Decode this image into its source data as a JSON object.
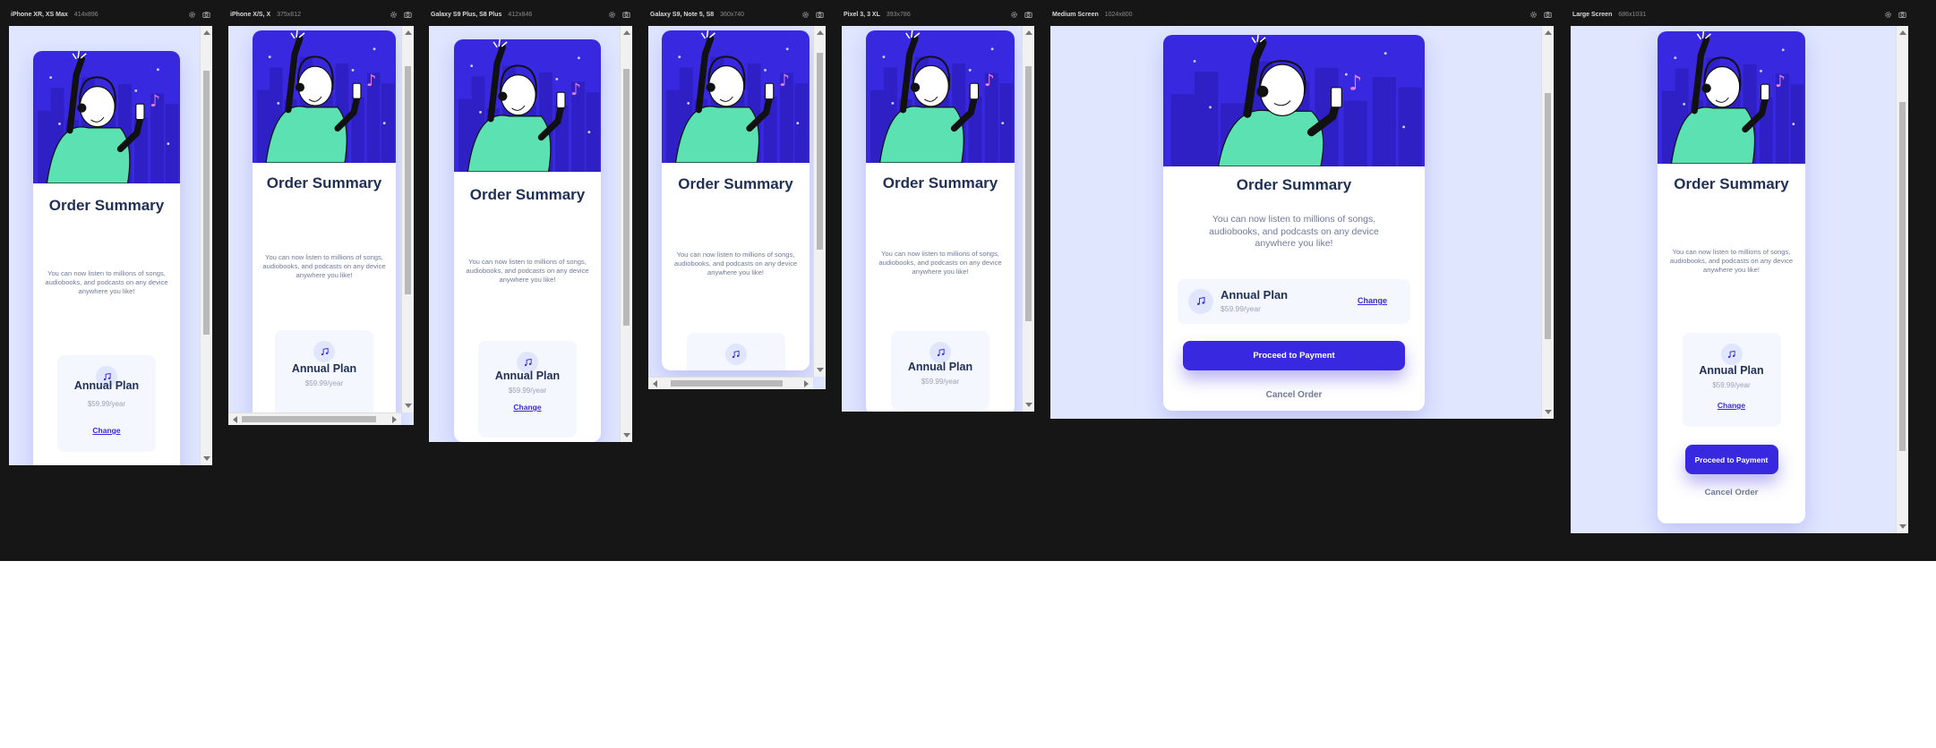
{
  "colors": {
    "background": "#161616",
    "viewport": "#dfe6fe",
    "primary": "#3829e0",
    "heading": "#1f2f56",
    "muted": "#707a96",
    "plan_box": "#f5f7ff",
    "person_shirt": "#5ce1b2",
    "music_note": "#ea7fe4"
  },
  "devices": [
    {
      "name": "iPhone XR, XS Max",
      "size": "414x896"
    },
    {
      "name": "iPhone X/S, X",
      "size": "375x812"
    },
    {
      "name": "Galaxy S9 Plus, S8 Plus",
      "size": "412x846"
    },
    {
      "name": "Galaxy S9, Note 5, S8",
      "size": "360x740"
    },
    {
      "name": "Pixel 3, 3 XL",
      "size": "393x786"
    },
    {
      "name": "Medium Screen",
      "size": "1024x800"
    },
    {
      "name": "Large Screen",
      "size": "686x1031"
    }
  ],
  "device_icons": [
    "settings-icon",
    "camera-icon"
  ],
  "order": {
    "title": "Order Summary",
    "description": "You can now listen to millions of songs, audiobooks, and podcasts on any device anywhere you like!",
    "plan_icon": "music-note-icon",
    "plan_name": "Annual Plan",
    "plan_price": "$59.99/year",
    "change_label": "Change",
    "proceed_label": "Proceed to Payment",
    "cancel_label": "Cancel Order"
  }
}
